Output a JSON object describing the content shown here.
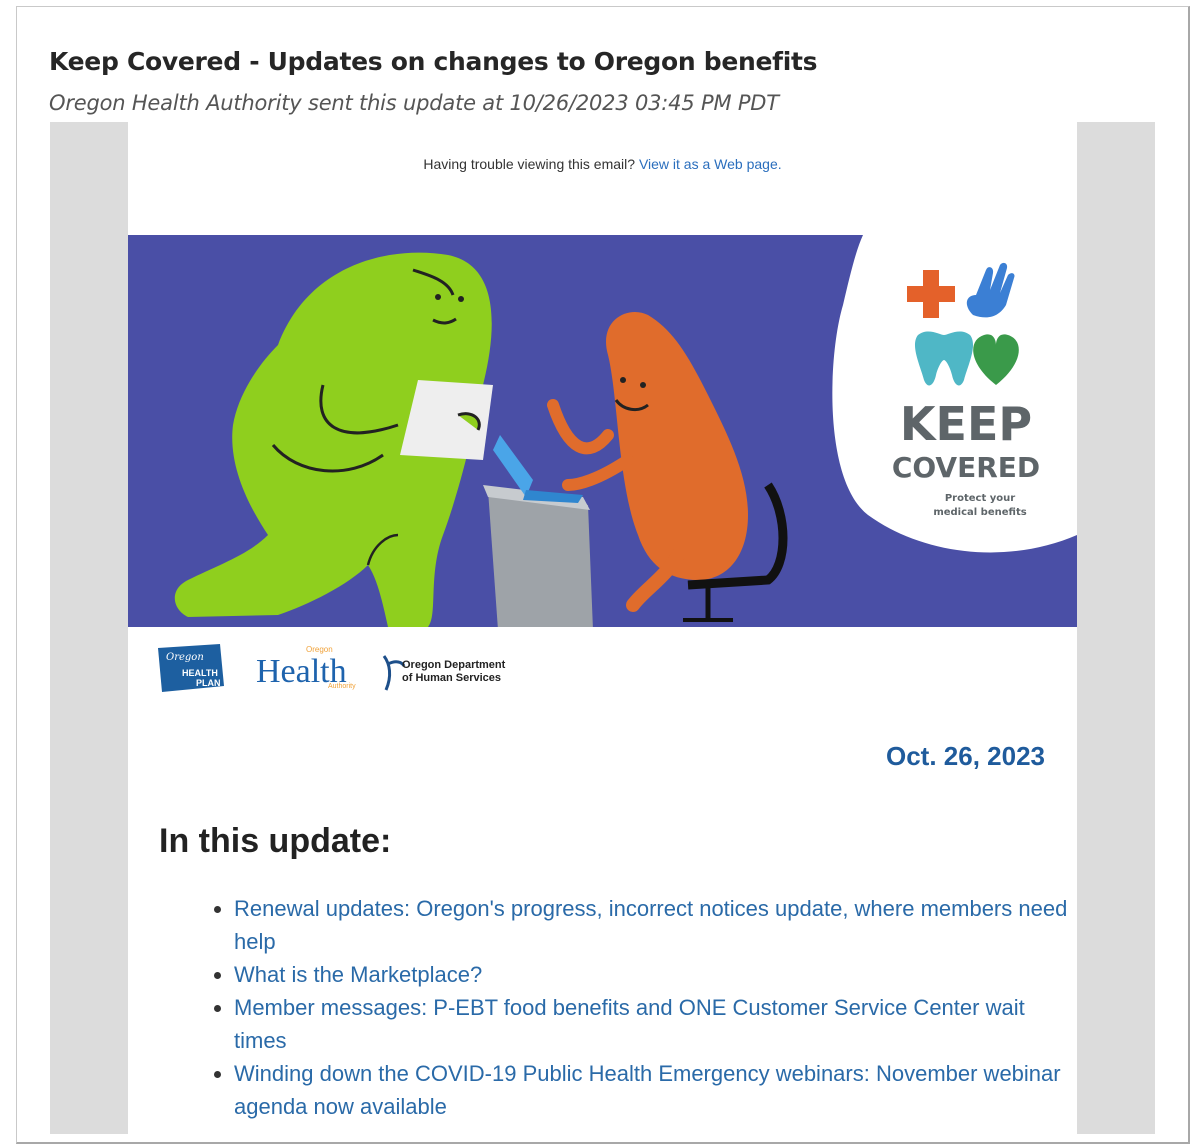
{
  "email": {
    "subject": "Keep Covered - Updates on changes to Oregon benefits",
    "sender_line": "Oregon Health Authority sent this update at 10/26/2023 03:45 PM PDT"
  },
  "header": {
    "trouble_text": "Having trouble viewing this email?",
    "web_link": "View it as a Web page."
  },
  "hero": {
    "brand_title_1": "KEEP",
    "brand_title_2": "COVERED",
    "brand_tag_1": "Protect your",
    "brand_tag_2": "medical benefits",
    "colors": {
      "background": "#4a4fa6",
      "green_character": "#8fcf1e",
      "orange_character": "#e06c2c",
      "cross": "#e4612a",
      "hand": "#3b7fd4",
      "tooth": "#4fb7c6",
      "heart": "#3a9a4a"
    }
  },
  "logos": {
    "ohp_text_1": "Oregon",
    "ohp_text_2": "HEALTH",
    "ohp_text_3": "PLAN",
    "oha_text": "Health",
    "oha_sub": "Oregon",
    "oha_sub2": "Authority",
    "odhs_text_1": "Oregon Department",
    "odhs_text_2": "of Human Services"
  },
  "body": {
    "date": "Oct. 26, 2023",
    "section_title": "In this update:",
    "items": [
      {
        "label": "Renewal updates: Oregon's progress, incorrect notices update, where members need help"
      },
      {
        "label": "What is the Marketplace?"
      },
      {
        "label": "Member messages: P-EBT food benefits and ONE Customer Service Center wait times"
      },
      {
        "label": "Winding down the COVID-19 Public Health Emergency webinars: November webinar agenda now available"
      }
    ]
  }
}
